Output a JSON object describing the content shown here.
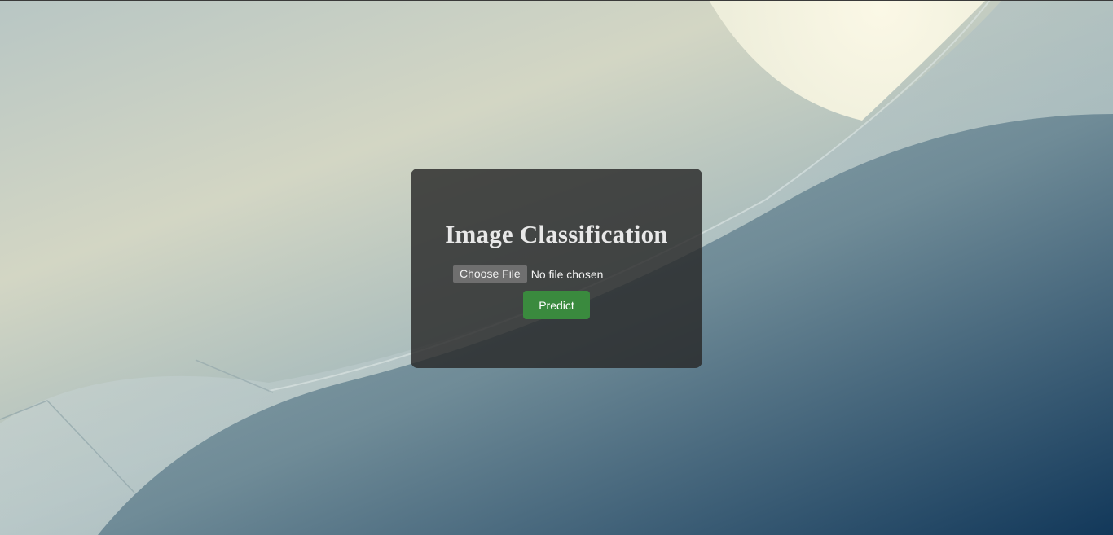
{
  "page": {
    "title": "Image Classification"
  },
  "upload": {
    "choose_file_label": "Choose File",
    "file_status": "No file chosen"
  },
  "actions": {
    "predict_label": "Predict"
  },
  "colors": {
    "card_background": "#282828",
    "predict_button": "#3a8a3e",
    "heading_text": "#e8e8e8"
  }
}
